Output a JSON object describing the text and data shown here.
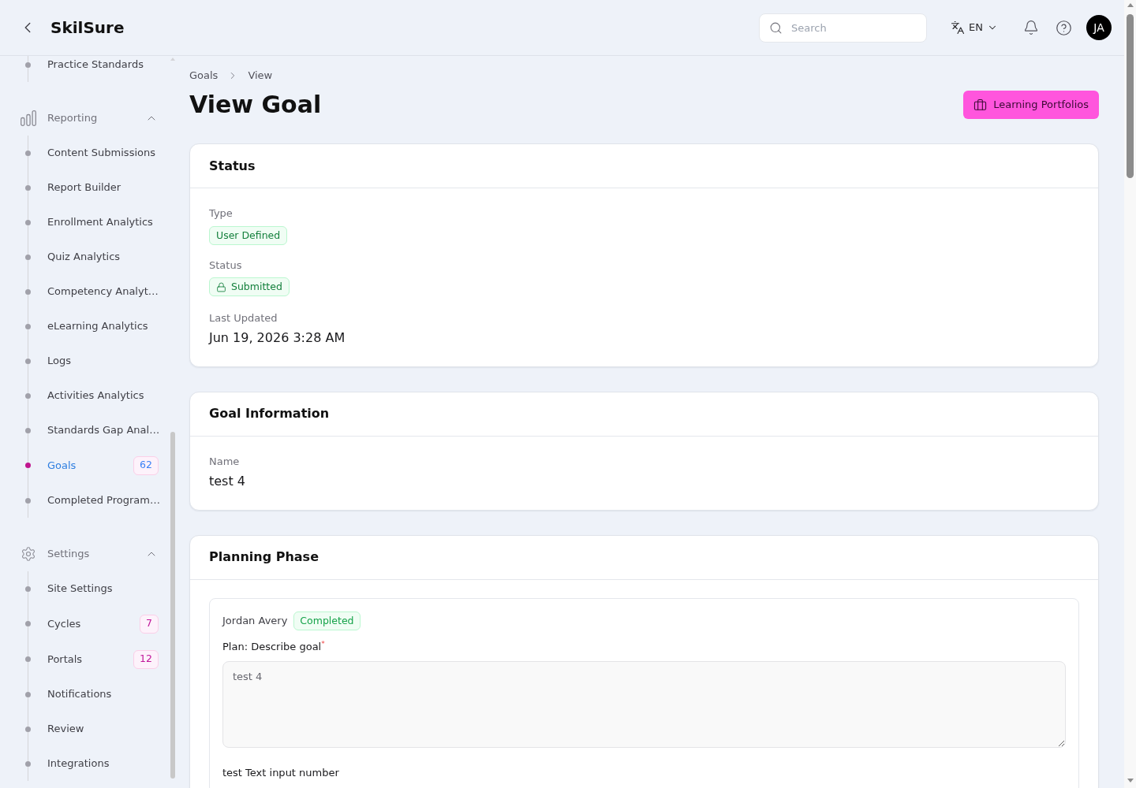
{
  "header": {
    "logo": "SkilSure",
    "search": {
      "placeholder": "Search"
    },
    "language": "EN",
    "avatar": {
      "initials": "JA"
    }
  },
  "sidebar": {
    "groups": [
      {
        "items": [
          {
            "label": "Practice Standards",
            "selected": false
          }
        ]
      },
      {
        "label": "Reporting",
        "expanded": true,
        "items": [
          {
            "label": "Content Submissions",
            "selected": false
          },
          {
            "label": "Report Builder",
            "selected": false
          },
          {
            "label": "Enrollment Analytics",
            "selected": false
          },
          {
            "label": "Quiz Analytics",
            "selected": false
          },
          {
            "label": "Competency Analyt…",
            "selected": false
          },
          {
            "label": "eLearning Analytics",
            "selected": false
          },
          {
            "label": "Logs",
            "selected": false
          },
          {
            "label": "Activities Analytics",
            "selected": false
          },
          {
            "label": "Standards Gap Anal…",
            "selected": false
          },
          {
            "label": "Goals",
            "selected": true,
            "badge": "62"
          },
          {
            "label": "Completed Program…",
            "selected": false
          }
        ]
      },
      {
        "label": "Settings",
        "expanded": true,
        "items": [
          {
            "label": "Site Settings",
            "selected": false
          },
          {
            "label": "Cycles",
            "selected": false,
            "badge": "7"
          },
          {
            "label": "Portals",
            "selected": false,
            "badge": "12"
          },
          {
            "label": "Notifications",
            "selected": false
          },
          {
            "label": "Review",
            "selected": false
          },
          {
            "label": "Integrations",
            "selected": false
          }
        ]
      }
    ]
  },
  "breadcrumb": [
    "Goals",
    "View"
  ],
  "page_title": "View Goal",
  "action_button": "Learning Portfolios",
  "status_card": {
    "title": "Status",
    "fields": [
      {
        "label": "Type",
        "kind": "badge",
        "value": "User Defined",
        "locked": false
      },
      {
        "label": "Status",
        "kind": "badge",
        "value": "Submitted",
        "locked": true
      },
      {
        "label": "Last Updated",
        "kind": "text",
        "value": "Jun 19, 2026 3:28 AM"
      }
    ]
  },
  "goal_information": {
    "title": "Goal Information",
    "fields": [
      {
        "label": "Name",
        "kind": "text",
        "value": "test 4"
      }
    ]
  },
  "planning_phase": {
    "title": "Planning Phase",
    "entries": [
      {
        "author": "Jordan Avery",
        "status": "Completed",
        "questions": [
          {
            "label": "Plan: Describe goal$^{*}$",
            "value": "test 4"
          },
          {
            "label": "test Text input number"
          }
        ]
      }
    ]
  }
}
